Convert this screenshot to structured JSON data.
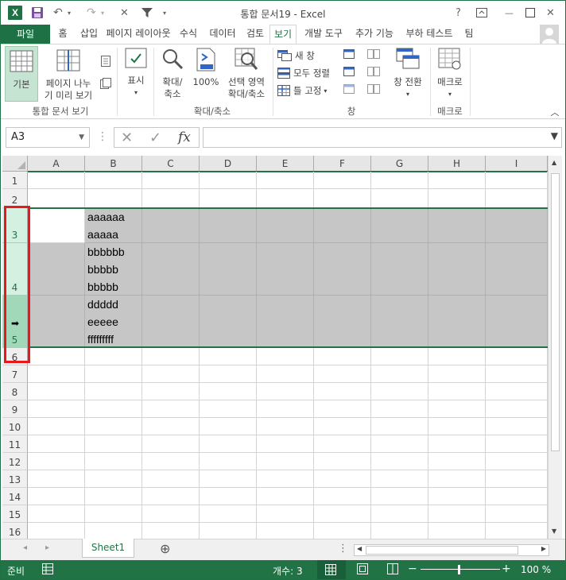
{
  "window": {
    "title": "통합 문서19 - Excel",
    "app_icon_letter": "X",
    "help": "?",
    "minimize": "—",
    "close": "✕"
  },
  "tabs": {
    "file": "파일",
    "items": [
      "홈",
      "삽입",
      "페이지 레이아웃",
      "수식",
      "데이터",
      "검토",
      "보기",
      "개발 도구",
      "추가 기능",
      "부하 테스트",
      "팀"
    ],
    "active": "보기"
  },
  "ribbon": {
    "normal": "기본",
    "page_break_line1": "페이지 나누",
    "page_break_line2": "기 미리 보기",
    "workbook_views_label": "통합 문서 보기",
    "show": "표시",
    "zoom_line1": "확대/",
    "zoom_line2": "축소",
    "zoom100": "100%",
    "zoom_sel_line1": "선택 영역",
    "zoom_sel_line2": "확대/축소",
    "zoom_group_label": "확대/축소",
    "new_window": "새 창",
    "arrange_all": "모두 정렬",
    "freeze_panes": "틀 고정",
    "switch_windows": "창 전환",
    "window_group_label": "창",
    "macros": "매크로",
    "macros_group_label": "매크로"
  },
  "formula_bar": {
    "name_box": "A3",
    "fx": "fx",
    "formula": ""
  },
  "grid": {
    "columns": [
      "A",
      "B",
      "C",
      "D",
      "E",
      "F",
      "G",
      "H",
      "I"
    ],
    "rows": [
      "1",
      "2",
      "3",
      "4",
      "5",
      "6",
      "7",
      "8",
      "9",
      "10",
      "11",
      "12",
      "13",
      "14",
      "15",
      "16"
    ],
    "b3_lines": [
      "aaaaaa",
      "aaaaa"
    ],
    "b4_lines": [
      "bbbbbb",
      "bbbbb",
      "bbbbb"
    ],
    "b5_lines": [
      "ddddd",
      "eeeee",
      "fffffffff"
    ],
    "selection_color": "#217346",
    "highlight_color": "#e8191d"
  },
  "sheets": {
    "active": "Sheet1",
    "add": "⊕"
  },
  "status": {
    "ready": "준비",
    "count": "개수: 3",
    "zoom": "100 %",
    "zoom_minus": "−",
    "zoom_plus": "+"
  }
}
